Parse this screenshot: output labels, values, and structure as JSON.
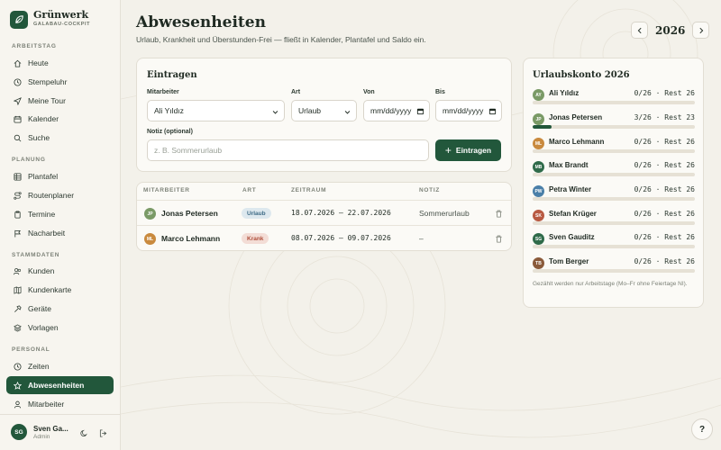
{
  "brand": {
    "name": "Grünwerk",
    "subtitle": "GALABAU-COCKPIT",
    "logo_icon": "leaf-icon"
  },
  "sidebar": {
    "sections": [
      {
        "title": "ARBEITSTAG",
        "items": [
          {
            "label": "Heute",
            "icon": "home-icon"
          },
          {
            "label": "Stempeluhr",
            "icon": "clock-icon"
          },
          {
            "label": "Meine Tour",
            "icon": "navigation-icon"
          },
          {
            "label": "Kalender",
            "icon": "calendar-icon"
          },
          {
            "label": "Suche",
            "icon": "search-icon"
          }
        ]
      },
      {
        "title": "PLANUNG",
        "items": [
          {
            "label": "Plantafel",
            "icon": "grid-icon"
          },
          {
            "label": "Routenplaner",
            "icon": "route-icon"
          },
          {
            "label": "Termine",
            "icon": "clipboard-icon"
          },
          {
            "label": "Nacharbeit",
            "icon": "flag-icon"
          }
        ]
      },
      {
        "title": "STAMMDATEN",
        "items": [
          {
            "label": "Kunden",
            "icon": "users-icon"
          },
          {
            "label": "Kundenkarte",
            "icon": "map-icon"
          },
          {
            "label": "Geräte",
            "icon": "hammer-icon"
          },
          {
            "label": "Vorlagen",
            "icon": "layers-icon"
          }
        ]
      },
      {
        "title": "PERSONAL",
        "items": [
          {
            "label": "Zeiten",
            "icon": "clock-icon"
          },
          {
            "label": "Abwesenheiten",
            "icon": "star-icon",
            "active": true
          },
          {
            "label": "Mitarbeiter",
            "icon": "user-icon"
          }
        ]
      }
    ],
    "user": {
      "initials": "SG",
      "name": "Sven Ga...",
      "role": "Admin"
    }
  },
  "page": {
    "title": "Abwesenheiten",
    "subtitle": "Urlaub, Krankheit und Überstunden-Frei — fließt in Kalender, Plantafel und Saldo ein.",
    "year": "2026"
  },
  "form": {
    "title": "Eintragen",
    "employee_label": "Mitarbeiter",
    "employee_value": "Ali Yıldız",
    "type_label": "Art",
    "type_value": "Urlaub",
    "from_label": "Von",
    "from_placeholder": "mm/dd/yyyy",
    "to_label": "Bis",
    "to_placeholder": "mm/dd/yyyy",
    "note_label": "Notiz (optional)",
    "note_placeholder": "z. B. Sommerurlaub",
    "submit_label": "Eintragen"
  },
  "table": {
    "headers": [
      "MITARBEITER",
      "ART",
      "ZEITRAUM",
      "NOTIZ"
    ],
    "rows": [
      {
        "initials": "JP",
        "avatar_color": "#7a9a66",
        "name": "Jonas Petersen",
        "type": "Urlaub",
        "type_bg": "#dde8ee",
        "type_fg": "#3d6a85",
        "period": "18.07.2026 – 22.07.2026",
        "note": "Sommerurlaub"
      },
      {
        "initials": "ML",
        "avatar_color": "#c98a3e",
        "name": "Marco Lehmann",
        "type": "Krank",
        "type_bg": "#f3ddd6",
        "type_fg": "#b0503c",
        "period": "08.07.2026 – 09.07.2026",
        "note": "–"
      }
    ]
  },
  "account": {
    "title": "Urlaubskonto 2026",
    "entries": [
      {
        "initials": "AY",
        "color": "#7a9a66",
        "name": "Ali Yıldız",
        "value": "0/26 · Rest 26",
        "used_fraction": 0
      },
      {
        "initials": "JP",
        "color": "#7a9a66",
        "name": "Jonas Petersen",
        "value": "3/26 · Rest 23",
        "used_fraction": 0.115
      },
      {
        "initials": "ML",
        "color": "#c98a3e",
        "name": "Marco Lehmann",
        "value": "0/26 · Rest 26",
        "used_fraction": 0
      },
      {
        "initials": "MB",
        "color": "#2f6b4a",
        "name": "Max Brandt",
        "value": "0/26 · Rest 26",
        "used_fraction": 0
      },
      {
        "initials": "PW",
        "color": "#4a7fa8",
        "name": "Petra Winter",
        "value": "0/26 · Rest 26",
        "used_fraction": 0
      },
      {
        "initials": "SK",
        "color": "#b85a42",
        "name": "Stefan Krüger",
        "value": "0/26 · Rest 26",
        "used_fraction": 0
      },
      {
        "initials": "SG",
        "color": "#2f6b4a",
        "name": "Sven Gauditz",
        "value": "0/26 · Rest 26",
        "used_fraction": 0
      },
      {
        "initials": "TB",
        "color": "#8a5a3a",
        "name": "Tom Berger",
        "value": "0/26 · Rest 26",
        "used_fraction": 0
      }
    ],
    "note": "Gezählt werden nur Arbeitstage (Mo–Fr ohne Feiertage NI)."
  },
  "help_label": "?",
  "colors": {
    "accent": "#22573b",
    "background": "#f3f1ea",
    "card": "#fbfaf6"
  }
}
